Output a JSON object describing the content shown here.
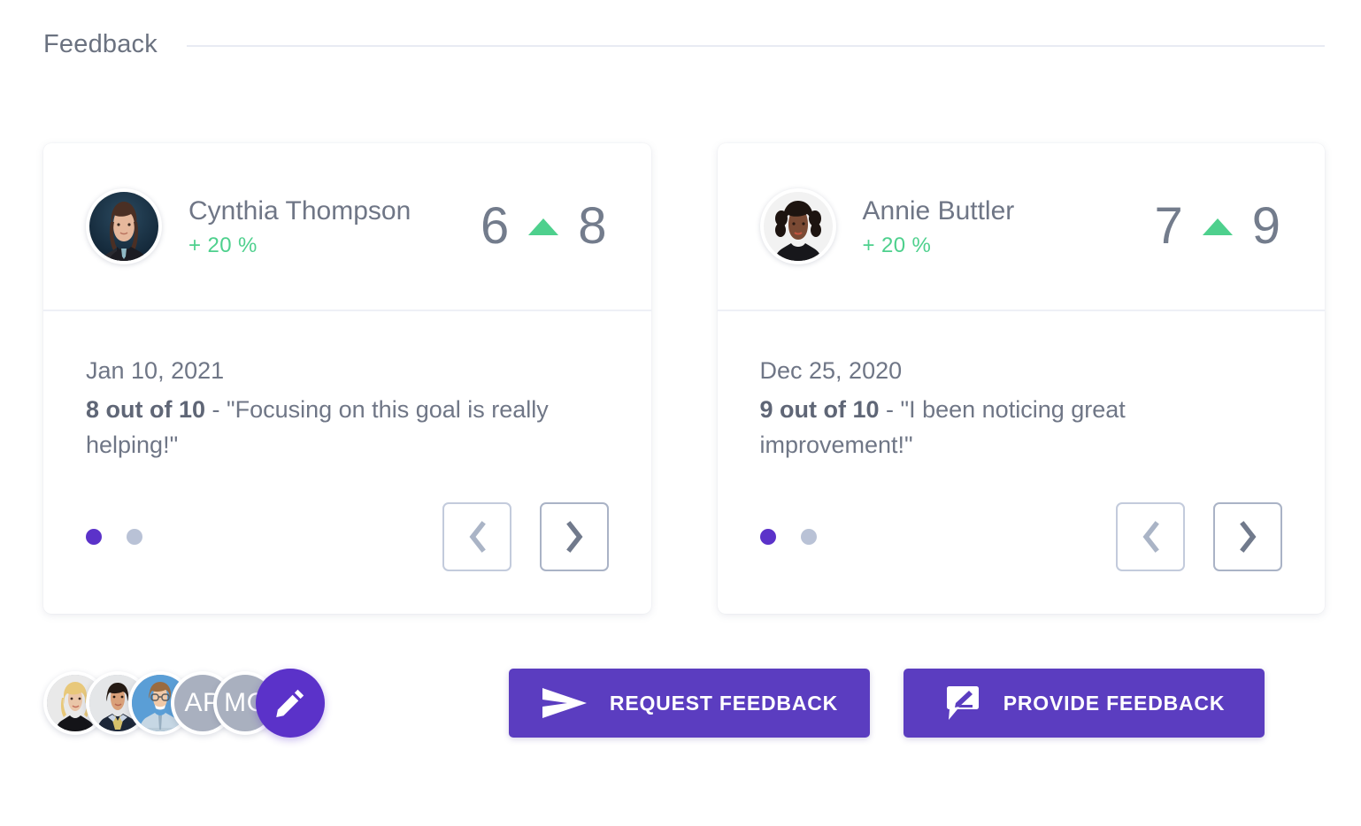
{
  "section": {
    "title": "Feedback"
  },
  "cards": [
    {
      "person_name": "Cynthia Thompson",
      "delta": "+ 20 %",
      "score_from": "6",
      "score_to": "8",
      "trend": "up",
      "date": "Jan 10, 2021",
      "score_label": "8 out of 10",
      "quote": " - \"Focusing on this goal is really helping!\"",
      "dots": [
        {
          "active": true
        },
        {
          "active": false
        }
      ],
      "prev_label": "Previous feedback",
      "next_label": "Next feedback",
      "avatar_alt": "Cynthia Thompson photo"
    },
    {
      "person_name": "Annie Buttler",
      "delta": "+ 20 %",
      "score_from": "7",
      "score_to": "9",
      "trend": "up",
      "date": "Dec 25, 2020",
      "score_label": "9 out of 10",
      "quote": " - \"I been noticing great improvement!\"",
      "dots": [
        {
          "active": true
        },
        {
          "active": false
        }
      ],
      "prev_label": "Previous feedback",
      "next_label": "Next feedback",
      "avatar_alt": "Annie Buttler photo"
    }
  ],
  "reviewers": [
    {
      "type": "photo",
      "alt": "Reviewer 1 photo"
    },
    {
      "type": "photo",
      "alt": "Reviewer 2 photo"
    },
    {
      "type": "photo",
      "alt": "Reviewer 3 photo"
    },
    {
      "type": "initials",
      "initials": "AP"
    },
    {
      "type": "initials",
      "initials": "MC"
    }
  ],
  "edit_button": {
    "label": "Edit reviewers",
    "icon": "pencil-icon"
  },
  "actions": {
    "request": {
      "label": "REQUEST FEEDBACK",
      "icon": "send-icon"
    },
    "provide": {
      "label": "PROVIDE FEEDBACK",
      "icon": "comment-edit-icon"
    }
  },
  "colors": {
    "accent_purple": "#5b3dc0",
    "dot_active": "#5b32c9",
    "dot_inactive": "#b9c2d6",
    "positive_green": "#4ed08d",
    "text_slate": "#6f7686",
    "divider": "#e8ebf3"
  }
}
